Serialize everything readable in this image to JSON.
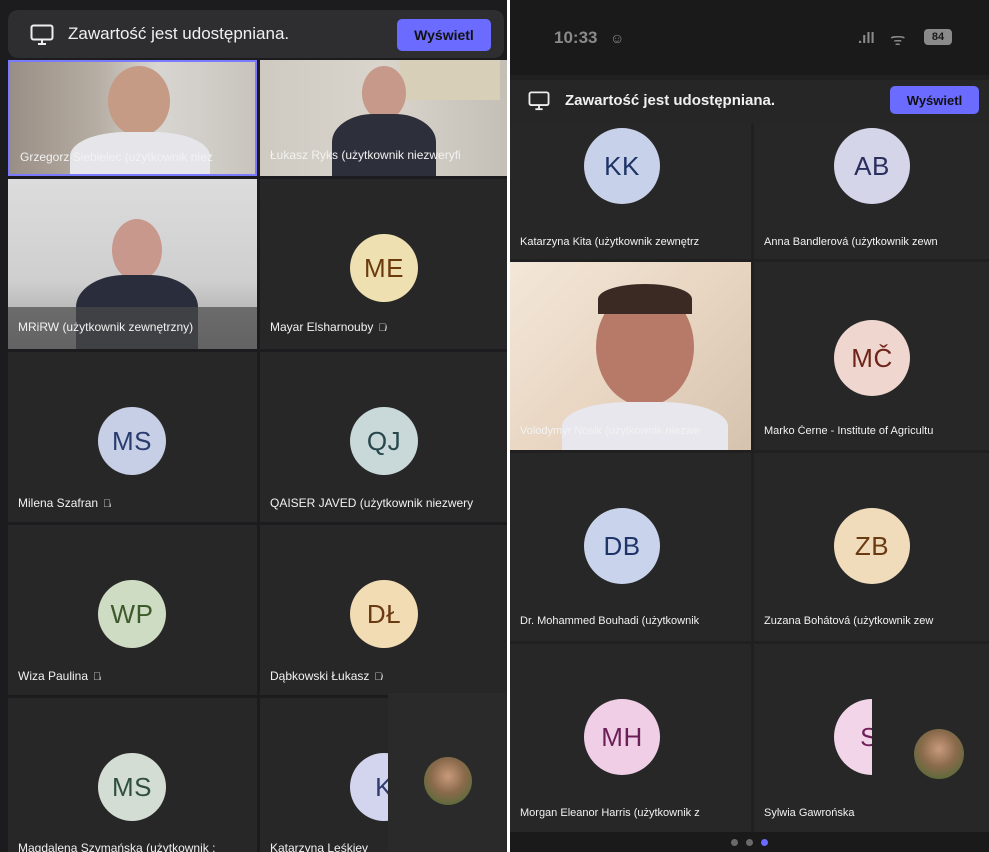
{
  "left": {
    "banner": {
      "text": "Zawartość jest udostępniana.",
      "button": "Wyświetl",
      "icon": "screen-share-icon"
    },
    "tiles": [
      {
        "name": "Grzegorz Siebielec (użytkownik niez",
        "video": true,
        "muted": false
      },
      {
        "name": "Łukasz Ryks (użytkownik niezweryfi",
        "video": true,
        "muted": false
      },
      {
        "name": "MRiRW (użytkownik zewnętrzny)",
        "video": true,
        "muted": false
      },
      {
        "name": "Mayar Elsharnouby",
        "initials": "ME",
        "color": "#efe0b1",
        "text_color": "#6b3b0e",
        "muted": true
      },
      {
        "name": "Milena Szafran",
        "initials": "MS",
        "color": "#c7cfe6",
        "text_color": "#2a3b6e",
        "muted": true
      },
      {
        "name": "QAISER JAVED (użytkownik niezwery",
        "initials": "QJ",
        "color": "#c9d8d8",
        "text_color": "#27474b",
        "muted": false
      },
      {
        "name": "Wiza Paulina",
        "initials": "WP",
        "color": "#cfdcc4",
        "text_color": "#3d5a2a",
        "muted": true
      },
      {
        "name": "Dąbkowski Łukasz",
        "initials": "DŁ",
        "color": "#f2dcb3",
        "text_color": "#6a3a12",
        "muted": true
      },
      {
        "name": "Magdalena Szymańska (użytkownik ;",
        "initials": "MS",
        "color": "#d4ddd4",
        "text_color": "#2f4f3e",
        "muted": false
      },
      {
        "name": "Katarzyna Leśkiev",
        "initials": "K",
        "color": "#d3d5ee",
        "text_color": "#2f3a6e",
        "muted": false
      }
    ]
  },
  "right": {
    "status_bar": {
      "time": "10:33",
      "battery": "84"
    },
    "banner": {
      "text": "Zawartość jest udostępniana.",
      "button": "Wyświetl",
      "icon": "screen-share-icon"
    },
    "tiles": [
      {
        "name": "Katarzyna Kita (użytkownik zewnętrz",
        "initials": "KK",
        "color": "#c8d1ea",
        "text_color": "#1e3366"
      },
      {
        "name": "Anna Bandlerová (użytkownik zewn",
        "initials": "AB",
        "color": "#d5d5ea",
        "text_color": "#2a2f5e"
      },
      {
        "name": "Volodymyr Nosik (użytkownik niezwe",
        "video": true
      },
      {
        "name": "Marko Černe - Institute of Agricultu",
        "initials": "MČ",
        "color": "#efd6cf",
        "text_color": "#6e2418"
      },
      {
        "name": "Dr. Mohammed Bouhadi (użytkownik",
        "initials": "DB",
        "color": "#c9d4ec",
        "text_color": "#1f3468"
      },
      {
        "name": "Zuzana Bohátová (użytkownik zew",
        "initials": "ZB",
        "color": "#f0dcbb",
        "text_color": "#6a3b12"
      },
      {
        "name": "Morgan Eleanor Harris (użytkownik z",
        "initials": "MH",
        "color": "#f0cfe6",
        "text_color": "#6a1f57"
      },
      {
        "name": "Sylwia Gawrońska",
        "initials": "S",
        "color": "#f2d5e8",
        "text_color": "#6e1f58"
      }
    ],
    "page_indicator": {
      "pages": 3,
      "active": 3
    }
  }
}
